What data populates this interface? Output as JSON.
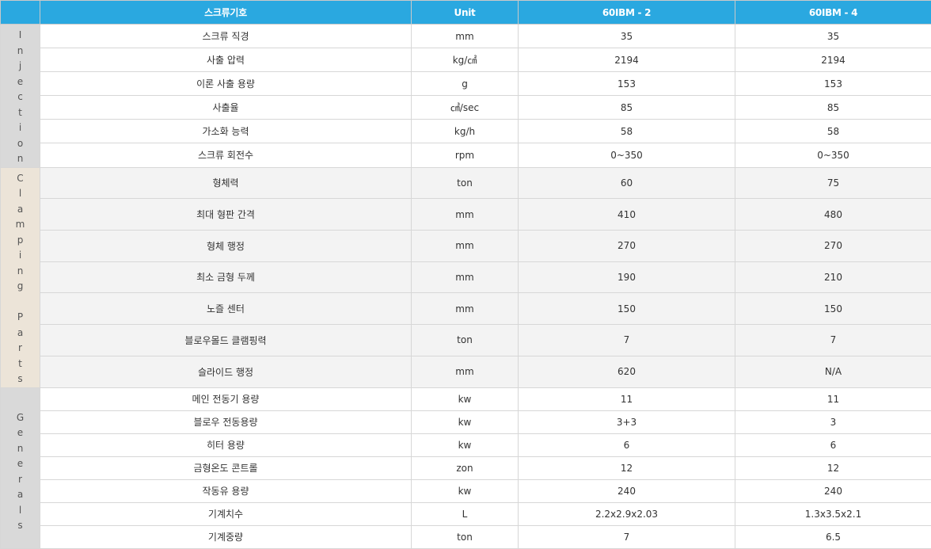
{
  "header": {
    "col_spec": "스크류기호",
    "col_unit": "Unit",
    "col_m1": "60IBM - 2",
    "col_m2": "60IBM - 4"
  },
  "sections": {
    "injection": "I\nn\nj\ne\nc\nt\ni\no\nn",
    "clamping": "C\nl\na\nm\np\ni\nn\ng\n\nP\na\nr\nt\ns",
    "generals": "G\ne\nn\ne\nr\na\nl\ns"
  },
  "rows": [
    {
      "spec": "스크류 직경",
      "unit": "mm",
      "m1": "35",
      "m2": "35"
    },
    {
      "spec": "사출 압력",
      "unit": "kg/㎠",
      "m1": "2194",
      "m2": "2194"
    },
    {
      "spec": "이론 사출 용량",
      "unit": "g",
      "m1": "153",
      "m2": "153"
    },
    {
      "spec": "사출율",
      "unit": "㎤/sec",
      "m1": "85",
      "m2": "85"
    },
    {
      "spec": "가소화 능력",
      "unit": "kg/h",
      "m1": "58",
      "m2": "58"
    },
    {
      "spec": "스크류 회전수",
      "unit": "rpm",
      "m1": "0~350",
      "m2": "0~350"
    },
    {
      "spec": "형체력",
      "unit": "ton",
      "m1": "60",
      "m2": "75"
    },
    {
      "spec": "최대 형판 간격",
      "unit": "mm",
      "m1": "410",
      "m2": "480"
    },
    {
      "spec": "형체 행정",
      "unit": "mm",
      "m1": "270",
      "m2": "270"
    },
    {
      "spec": "최소 금형 두께",
      "unit": "mm",
      "m1": "190",
      "m2": "210"
    },
    {
      "spec": "노즐 센터",
      "unit": "mm",
      "m1": "150",
      "m2": "150"
    },
    {
      "spec": "블로우몰드 클램핑력",
      "unit": "ton",
      "m1": "7",
      "m2": "7"
    },
    {
      "spec": "슬라이드 행정",
      "unit": "mm",
      "m1": "620",
      "m2": "N/A"
    },
    {
      "spec": "메인 전동기 용량",
      "unit": "kw",
      "m1": "11",
      "m2": "11"
    },
    {
      "spec": "블로우 전동용량",
      "unit": "kw",
      "m1": "3+3",
      "m2": "3"
    },
    {
      "spec": "히터 용량",
      "unit": "kw",
      "m1": "6",
      "m2": "6"
    },
    {
      "spec": "금형온도 콘트롤",
      "unit": "zon",
      "m1": "12",
      "m2": "12"
    },
    {
      "spec": "작동유 용량",
      "unit": "kw",
      "m1": "240",
      "m2": "240"
    },
    {
      "spec": "기계치수",
      "unit": "L",
      "m1": "2.2x2.9x2.03",
      "m2": "1.3x3.5x2.1"
    },
    {
      "spec": "기계중량",
      "unit": "ton",
      "m1": "7",
      "m2": "6.5"
    }
  ]
}
